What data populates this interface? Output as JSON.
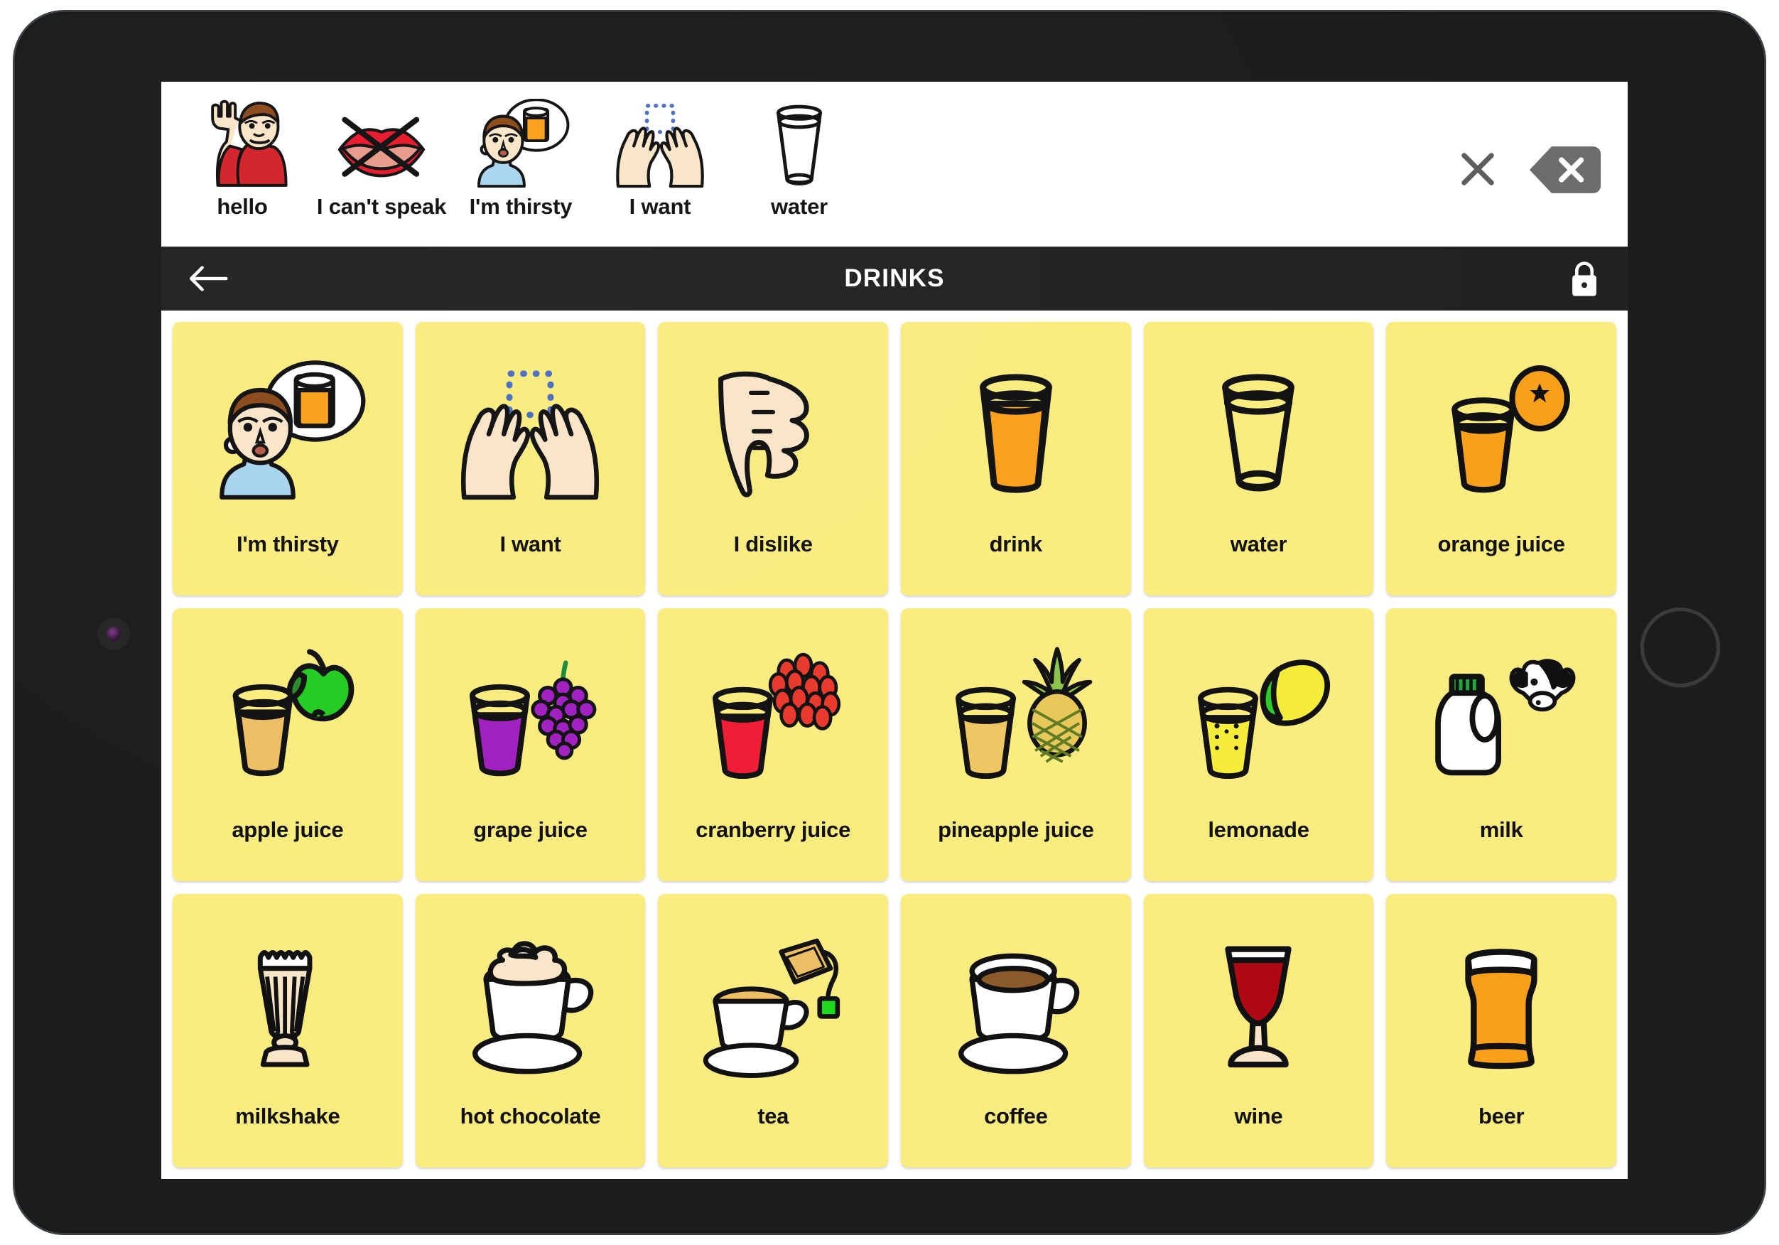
{
  "app": {
    "device": "tablet",
    "screen_background": "#ffffff",
    "bezel_color": "#1c1c1c"
  },
  "sentence_bar": {
    "items": [
      {
        "label": "hello",
        "icon": "person-waving-hello-icon"
      },
      {
        "label": "I can't speak",
        "icon": "crossed-out-lips-icon"
      },
      {
        "label": "I'm thirsty",
        "icon": "person-thinking-of-drink-icon"
      },
      {
        "label": "I want",
        "icon": "two-hands-reaching-icon"
      },
      {
        "label": "water",
        "icon": "glass-of-water-icon"
      }
    ],
    "clear_all": {
      "label": "",
      "icon": "close-x-icon"
    },
    "backspace": {
      "label": "",
      "icon": "backspace-delete-icon"
    }
  },
  "header": {
    "title": "DRINKS",
    "back": {
      "icon": "back-arrow-icon"
    },
    "lock": {
      "icon": "padlock-icon"
    }
  },
  "board": {
    "columns": 6,
    "rows": 3,
    "cell_color": "#FBEC7F",
    "cells": [
      {
        "label": "I'm thirsty",
        "icon": "person-thinking-of-drink-icon"
      },
      {
        "label": "I want",
        "icon": "two-hands-reaching-icon"
      },
      {
        "label": "I dislike",
        "icon": "thumbs-down-icon"
      },
      {
        "label": "drink",
        "icon": "glass-of-orange-drink-icon"
      },
      {
        "label": "water",
        "icon": "empty-glass-of-water-icon"
      },
      {
        "label": "orange juice",
        "icon": "glass-with-orange-icon"
      },
      {
        "label": "apple juice",
        "icon": "glass-with-green-apple-icon"
      },
      {
        "label": "grape juice",
        "icon": "glass-with-purple-grapes-icon"
      },
      {
        "label": "cranberry juice",
        "icon": "glass-with-cranberries-icon"
      },
      {
        "label": "pineapple juice",
        "icon": "glass-with-pineapple-icon"
      },
      {
        "label": "lemonade",
        "icon": "glass-with-lemon-icon"
      },
      {
        "label": "milk",
        "icon": "milk-jug-with-cow-icon"
      },
      {
        "label": "milkshake",
        "icon": "milkshake-glass-icon"
      },
      {
        "label": "hot chocolate",
        "icon": "mug-with-whipped-cream-icon"
      },
      {
        "label": "tea",
        "icon": "teacup-with-teabag-icon"
      },
      {
        "label": "coffee",
        "icon": "coffee-cup-icon"
      },
      {
        "label": "wine",
        "icon": "wine-glass-icon"
      },
      {
        "label": "beer",
        "icon": "beer-pint-icon"
      }
    ]
  },
  "colors": {
    "cell_yellow": "#FBEC7F",
    "header_dark": "#222222",
    "bezel": "#1c1c1c",
    "orange": "#F9A01B",
    "red": "#E8192C",
    "purple": "#A020C0",
    "green": "#22CC22",
    "lemon_yellow": "#F5ED3A",
    "wine_red": "#AF0A14",
    "skin": "#FAE5C8",
    "hair_brown": "#8B4A1A",
    "shirt_blue": "#A8D4EE",
    "shirt_red": "#D2232A",
    "want_square_blue": "#4A6FC0"
  }
}
